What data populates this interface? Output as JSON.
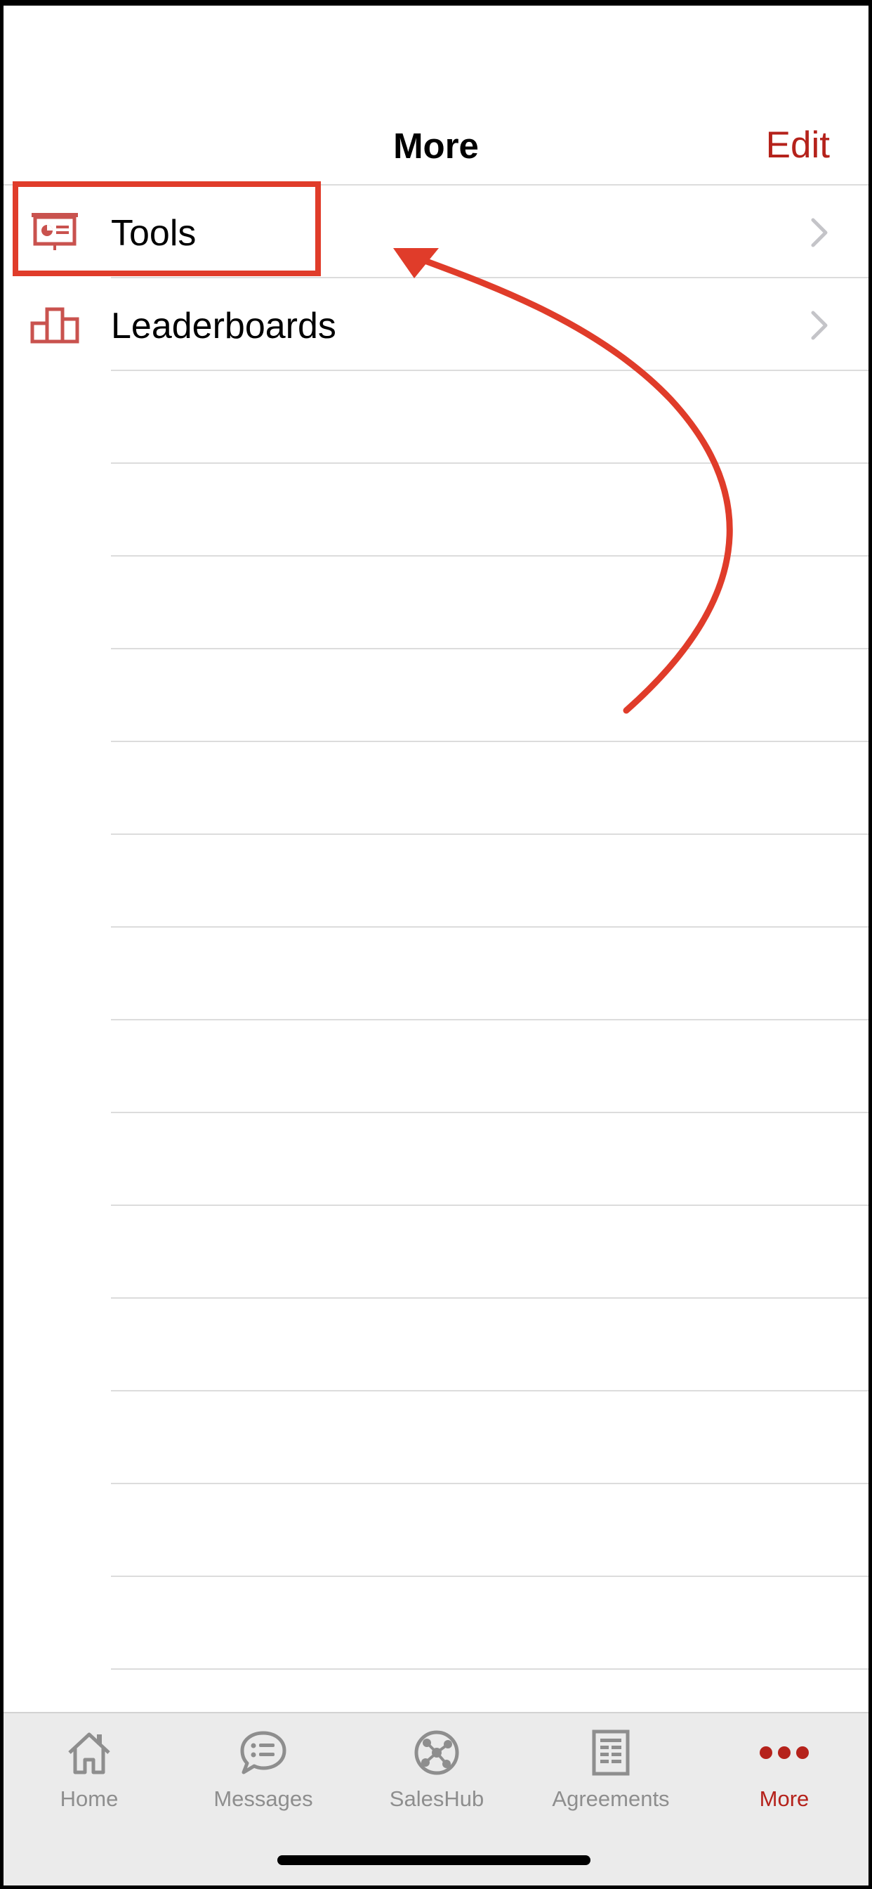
{
  "navbar": {
    "title": "More",
    "edit_label": "Edit"
  },
  "list": {
    "items": [
      {
        "label": "Tools",
        "icon": "presentation-icon"
      },
      {
        "label": "Leaderboards",
        "icon": "podium-icon"
      }
    ]
  },
  "tabbar": {
    "tabs": [
      {
        "label": "Home",
        "icon": "home-icon",
        "active": false
      },
      {
        "label": "Messages",
        "icon": "chat-bubble-icon",
        "active": false
      },
      {
        "label": "SalesHub",
        "icon": "network-globe-icon",
        "active": false
      },
      {
        "label": "Agreements",
        "icon": "document-icon",
        "active": false
      },
      {
        "label": "More",
        "icon": "more-dots-icon",
        "active": true
      }
    ]
  },
  "colors": {
    "accent": "#b5221b",
    "icon_red": "#c9524e",
    "annotation": "#e03c2a",
    "tab_inactive": "#8e8e8e"
  }
}
